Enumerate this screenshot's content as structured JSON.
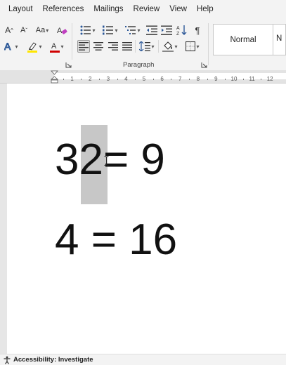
{
  "menu": [
    "Layout",
    "References",
    "Mailings",
    "Review",
    "View",
    "Help"
  ],
  "ribbon": {
    "font_grow_label": "A",
    "font_shrink_label": "A",
    "change_case_label": "Aa",
    "paragraph_group_label": "Paragraph",
    "style_normal_label": "Normal",
    "style_next_label": "N",
    "highlight_color": "#ffe600",
    "font_color": "#d00000"
  },
  "ruler": {
    "ticks": [
      "1",
      "2",
      "3",
      "4",
      "5",
      "6",
      "7",
      "8",
      "9",
      "10",
      "11",
      "12"
    ]
  },
  "document": {
    "line1_base": "32",
    "line1_rest": "= 9",
    "line2": "4 = 16"
  },
  "status": {
    "accessibility": "Accessibility: Investigate"
  }
}
